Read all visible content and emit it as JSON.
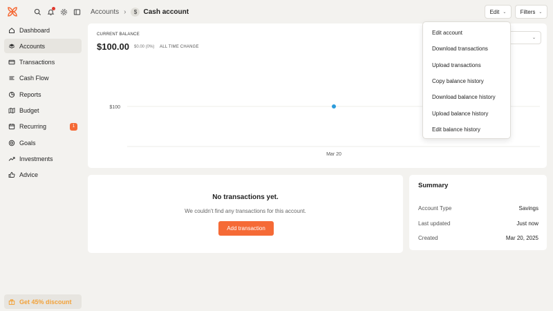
{
  "colors": {
    "accent": "#f56a36",
    "notification": "#e0382e",
    "chart_point": "#2d9cdb",
    "discount_text": "#f2a23a"
  },
  "sidebar": {
    "items": [
      {
        "label": "Dashboard",
        "icon": "home-icon",
        "active": false
      },
      {
        "label": "Accounts",
        "icon": "layers-icon",
        "active": true
      },
      {
        "label": "Transactions",
        "icon": "credit-card-icon",
        "active": false
      },
      {
        "label": "Cash Flow",
        "icon": "bars-icon",
        "active": false
      },
      {
        "label": "Reports",
        "icon": "pie-chart-icon",
        "active": false
      },
      {
        "label": "Budget",
        "icon": "map-icon",
        "active": false
      },
      {
        "label": "Recurring",
        "icon": "calendar-icon",
        "active": false,
        "badge": "1"
      },
      {
        "label": "Goals",
        "icon": "target-icon",
        "active": false
      },
      {
        "label": "Investments",
        "icon": "trend-up-icon",
        "active": false
      },
      {
        "label": "Advice",
        "icon": "thumbs-up-icon",
        "active": false
      }
    ],
    "discount_label": "Get 45% discount"
  },
  "header": {
    "breadcrumb_parent": "Accounts",
    "account_icon_glyph": "$",
    "title": "Cash account",
    "edit_label": "Edit",
    "filters_label": "Filters"
  },
  "balance": {
    "label": "CURRENT BALANCE",
    "amount": "$100.00",
    "change": "$0.00 (0%)",
    "change_label": "ALL TIME CHANGE"
  },
  "chart_data": {
    "type": "line",
    "x": [
      "Mar 20"
    ],
    "y": [
      100
    ],
    "y_tick_label": "$100",
    "x_tick_label": "Mar 20"
  },
  "transactions": {
    "empty_title": "No transactions yet.",
    "empty_desc": "We couldn't find any transactions for this account.",
    "add_label": "Add transaction"
  },
  "summary": {
    "title": "Summary",
    "rows": [
      {
        "key": "Account Type",
        "value": "Savings"
      },
      {
        "key": "Last updated",
        "value": "Just now"
      },
      {
        "key": "Created",
        "value": "Mar 20, 2025"
      }
    ]
  },
  "edit_menu": {
    "items": [
      "Edit account",
      "Download transactions",
      "Upload transactions",
      "Copy balance history",
      "Download balance history",
      "Upload balance history",
      "Edit balance history"
    ]
  }
}
